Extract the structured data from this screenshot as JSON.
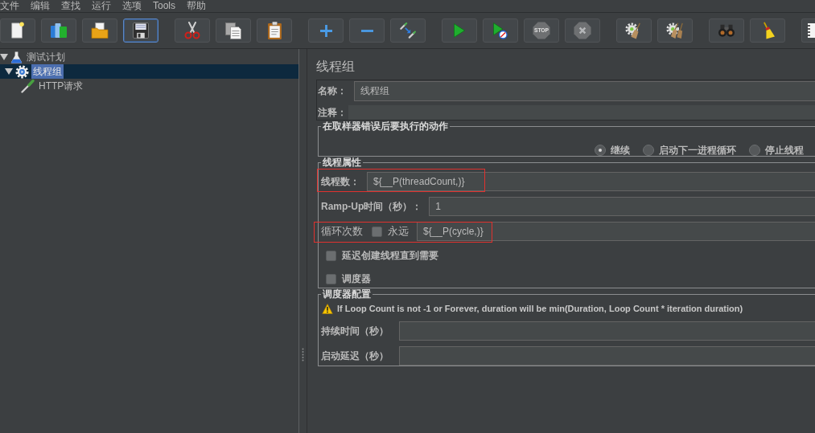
{
  "menu_bar": {
    "items": [
      "文件",
      "编辑",
      "查找",
      "运行",
      "选项",
      "Tools",
      "帮助"
    ]
  },
  "toolbar": {
    "groups": [
      {
        "buttons": [
          {
            "kind": "new",
            "disabled": false,
            "focused": false
          },
          {
            "kind": "templates",
            "disabled": false,
            "focused": false
          },
          {
            "kind": "open",
            "disabled": false,
            "focused": false
          },
          {
            "kind": "save",
            "disabled": false,
            "focused": true
          }
        ]
      },
      {
        "buttons": [
          {
            "kind": "cut",
            "disabled": false,
            "focused": false
          },
          {
            "kind": "copy",
            "disabled": false,
            "focused": false
          },
          {
            "kind": "paste",
            "disabled": false,
            "focused": false
          }
        ]
      },
      {
        "buttons": [
          {
            "kind": "expand",
            "disabled": false,
            "focused": false
          },
          {
            "kind": "collapse",
            "disabled": false,
            "focused": false
          },
          {
            "kind": "toggle",
            "disabled": false,
            "focused": false
          }
        ]
      },
      {
        "buttons": [
          {
            "kind": "start",
            "disabled": false,
            "focused": false
          },
          {
            "kind": "start_no_pauses",
            "disabled": false,
            "focused": false
          },
          {
            "kind": "stop",
            "label": "STOP",
            "disabled": true,
            "focused": false
          },
          {
            "kind": "shutdown",
            "disabled": true,
            "focused": false
          }
        ]
      },
      {
        "buttons": [
          {
            "kind": "clear",
            "disabled": false,
            "focused": false
          },
          {
            "kind": "clear_all",
            "disabled": false,
            "focused": false
          }
        ]
      },
      {
        "buttons": [
          {
            "kind": "search",
            "disabled": false,
            "focused": false
          },
          {
            "kind": "reset_search",
            "disabled": false,
            "focused": false
          }
        ]
      },
      {
        "buttons": [
          {
            "kind": "list",
            "disabled": false,
            "focused": false
          }
        ]
      }
    ]
  },
  "tree": {
    "items": [
      {
        "label": "测试计划",
        "kind": "test_plan",
        "expanded": true,
        "selected": false,
        "children": [
          {
            "label": "线程组",
            "kind": "thread_group",
            "expanded": true,
            "selected": true,
            "children": [
              {
                "label": "HTTP请求",
                "kind": "sampler",
                "selected": false
              }
            ]
          }
        ]
      }
    ]
  },
  "editor": {
    "title": "线程组",
    "name_field": {
      "label": "名称：",
      "value": "线程组"
    },
    "comment_field": {
      "label": "注释："
    },
    "error_action": {
      "legend": "在取样器错误后要执行的动作",
      "options": [
        {
          "label": "继续",
          "selected": true
        },
        {
          "label": "启动下一进程循环",
          "selected": false
        },
        {
          "label": "停止线程",
          "selected": false
        }
      ]
    },
    "thread_properties": {
      "legend": "线程属性",
      "rows": [
        {
          "kind": "field",
          "label": "线程数：",
          "value": "${__P(threadCount,)}",
          "highlighted": true
        },
        {
          "kind": "field",
          "label": "Ramp-Up时间（秒）：",
          "value": "1",
          "highlighted": false
        },
        {
          "kind": "loop",
          "label": "循环次数",
          "checkbox_label": "永远",
          "checked": false,
          "value": "${__P(cycle,)}",
          "highlighted": true
        },
        {
          "kind": "checkbox",
          "label": "延迟创建线程直到需要",
          "checked": false
        },
        {
          "kind": "checkbox",
          "label": "调度器",
          "checked": false
        }
      ]
    },
    "scheduler": {
      "legend": "调度器配置",
      "warning": "If Loop Count is not -1 or Forever, duration will be min(Duration, Loop Count * iteration duration)",
      "fields": [
        {
          "label": "持续时间（秒）"
        },
        {
          "label": "启动延迟（秒）"
        }
      ]
    }
  }
}
